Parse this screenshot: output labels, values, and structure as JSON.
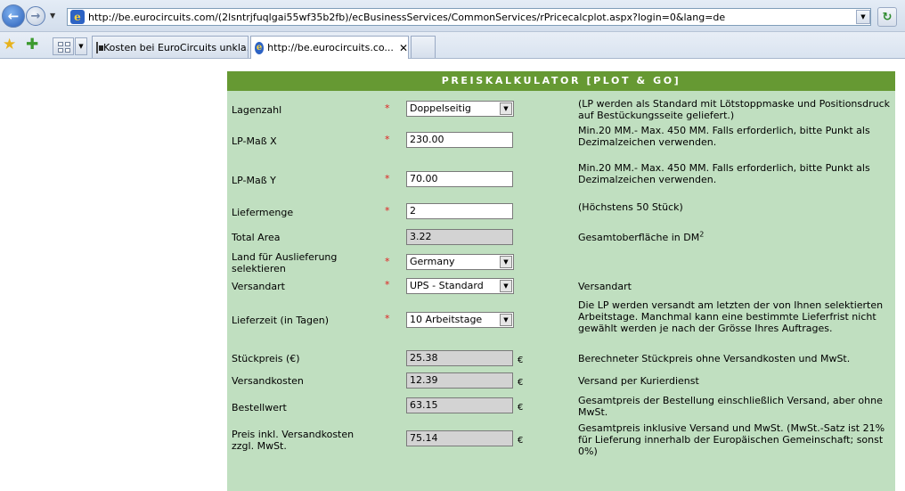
{
  "browser": {
    "address_url": "http://be.eurocircuits.com/(2lsntrjfuqlgai55wf35b2fb)/ecBusinessServices/CommonServices/rPricecalcplot.aspx?login=0&lang=de",
    "tabs": [
      {
        "label": "Kosten bei EuroCircuits unkla..."
      },
      {
        "label": "http://be.eurocircuits.co..."
      }
    ]
  },
  "calculator": {
    "title": "PREISKALKULATOR  [PLOT & GO]",
    "required_marker": "*",
    "currency_symbol": "€",
    "rows": {
      "lagenzahl": {
        "label": "Lagenzahl",
        "value": "Doppelseitig",
        "desc": "(LP werden als Standard mit Lötstoppmaske und Positionsdruck auf Bestückungsseite geliefert.)"
      },
      "lp_mass_x": {
        "label": "LP-Maß X",
        "value": "230.00",
        "desc": "Min.20 MM.- Max. 450 MM. Falls erforderlich, bitte Punkt als Dezimalzeichen verwenden."
      },
      "lp_mass_y": {
        "label": "LP-Maß Y",
        "value": "70.00",
        "desc": "Min.20 MM.- Max. 450 MM. Falls erforderlich, bitte Punkt als Dezimalzeichen verwenden."
      },
      "liefermenge": {
        "label": "Liefermenge",
        "value": "2",
        "desc": "(Höchstens 50 Stück)"
      },
      "total_area": {
        "label": "Total Area",
        "value": "3.22",
        "desc": "Gesamtoberfläche in DM",
        "desc_sup": "2"
      },
      "land": {
        "label": "Land für Auslieferung selektieren",
        "value": "Germany"
      },
      "versandart": {
        "label": "Versandart",
        "value": "UPS - Standard",
        "desc": "Versandart"
      },
      "lieferzeit": {
        "label": "Lieferzeit (in Tagen)",
        "value": "10 Arbeitstage",
        "desc": "Die LP werden versandt am letzten der von Ihnen selektierten Arbeitstage. Manchmal kann eine bestimmte Lieferfrist nicht gewählt werden je nach der Grösse Ihres Auftrages."
      },
      "stueckpreis": {
        "label": "Stückpreis (€)",
        "value": "25.38",
        "desc": "Berechneter Stückpreis ohne Versandkosten und MwSt."
      },
      "versandkosten": {
        "label": "Versandkosten",
        "value": "12.39",
        "desc": "Versand per Kurierdienst"
      },
      "bestellwert": {
        "label": "Bestellwert",
        "value": "63.15",
        "desc": "Gesamtpreis der Bestellung einschließlich Versand, aber ohne MwSt."
      },
      "preis_inkl": {
        "label": "Preis inkl. Versandkosten zzgl. MwSt.",
        "value": "75.14",
        "desc": "Gesamtpreis inklusive Versand und MwSt. (MwSt.-Satz ist 21% für Lieferung innerhalb der Europäischen Gemeinschaft; sonst 0%)"
      }
    }
  }
}
